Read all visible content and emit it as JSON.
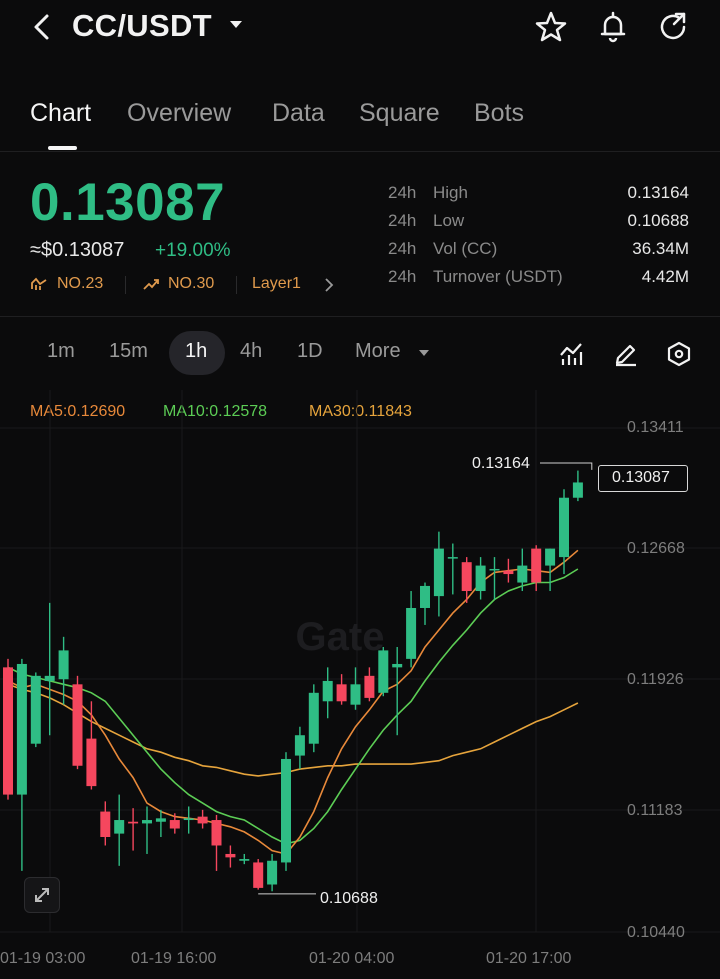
{
  "header": {
    "pair": "CC/USDT"
  },
  "tabs": [
    {
      "label": "Chart",
      "active": true
    },
    {
      "label": "Overview",
      "active": false
    },
    {
      "label": "Data",
      "active": false
    },
    {
      "label": "Square",
      "active": false
    },
    {
      "label": "Bots",
      "active": false
    }
  ],
  "ticker": {
    "last_price": "0.13087",
    "usd_value": "≈$0.13087",
    "change": "+19.00%",
    "rank1": "NO.23",
    "rank2": "NO.30",
    "category": "Layer1"
  },
  "stats": [
    {
      "period": "24h",
      "label": "High",
      "value": "0.13164"
    },
    {
      "period": "24h",
      "label": "Low",
      "value": "0.10688"
    },
    {
      "period": "24h",
      "label": "Vol (CC)",
      "value": "36.34M"
    },
    {
      "period": "24h",
      "label": "Turnover (USDT)",
      "value": "4.42M"
    }
  ],
  "intervals": [
    {
      "label": "1m",
      "active": false
    },
    {
      "label": "15m",
      "active": false
    },
    {
      "label": "1h",
      "active": true
    },
    {
      "label": "4h",
      "active": false
    },
    {
      "label": "1D",
      "active": false
    }
  ],
  "more_label": "More",
  "watermark": "Gate",
  "colors": {
    "up": "#2fbd85",
    "down": "#f5475e",
    "ma5": "#e8893a",
    "ma10": "#5ccd55",
    "ma30": "#e6a43c",
    "background": "#0b0b0c"
  },
  "chart_data": {
    "type": "candlestick",
    "interval": "1h",
    "ma_legend": [
      {
        "name": "MA5",
        "value": "0.12690",
        "text": "MA5:0.12690"
      },
      {
        "name": "MA10",
        "value": "0.12578",
        "text": "MA10:0.12578"
      },
      {
        "name": "MA30",
        "value": "0.11843",
        "text": "MA30:0.11843"
      }
    ],
    "y_ticks": [
      "0.13411",
      "0.12668",
      "0.11926",
      "0.11183",
      "0.10440"
    ],
    "ylim": [
      0.1044,
      0.13411
    ],
    "x_ticks": [
      {
        "label": "01-19 03:00",
        "index": 1
      },
      {
        "label": "01-19 16:00",
        "index": 14
      },
      {
        "label": "01-20 04:00",
        "index": 26
      },
      {
        "label": "01-20 17:00",
        "index": 39
      }
    ],
    "current_price_label": "0.13087",
    "high_marker": {
      "label": "0.13164",
      "value": 0.13164,
      "index": 42
    },
    "low_marker": {
      "label": "0.10688",
      "value": 0.10688,
      "index": 18
    },
    "candles": [
      {
        "o": 0.12,
        "h": 0.1205,
        "l": 0.1122,
        "c": 0.1125
      },
      {
        "o": 0.1125,
        "h": 0.1205,
        "l": 0.108,
        "c": 0.1202
      },
      {
        "o": 0.1155,
        "h": 0.1197,
        "l": 0.1153,
        "c": 0.1195
      },
      {
        "o": 0.1192,
        "h": 0.1238,
        "l": 0.116,
        "c": 0.1195
      },
      {
        "o": 0.1193,
        "h": 0.1218,
        "l": 0.1178,
        "c": 0.121
      },
      {
        "o": 0.119,
        "h": 0.1195,
        "l": 0.114,
        "c": 0.1142
      },
      {
        "o": 0.1158,
        "h": 0.118,
        "l": 0.1128,
        "c": 0.113
      },
      {
        "o": 0.1115,
        "h": 0.1121,
        "l": 0.1095,
        "c": 0.11
      },
      {
        "o": 0.1102,
        "h": 0.1125,
        "l": 0.1083,
        "c": 0.111
      },
      {
        "o": 0.1109,
        "h": 0.1117,
        "l": 0.1092,
        "c": 0.1108
      },
      {
        "o": 0.1108,
        "h": 0.1118,
        "l": 0.109,
        "c": 0.111
      },
      {
        "o": 0.1109,
        "h": 0.1116,
        "l": 0.11,
        "c": 0.1111
      },
      {
        "o": 0.111,
        "h": 0.1114,
        "l": 0.1102,
        "c": 0.1105
      },
      {
        "o": 0.111,
        "h": 0.1118,
        "l": 0.1102,
        "c": 0.1111
      },
      {
        "o": 0.1112,
        "h": 0.1116,
        "l": 0.1105,
        "c": 0.1108
      },
      {
        "o": 0.111,
        "h": 0.1113,
        "l": 0.108,
        "c": 0.1095
      },
      {
        "o": 0.109,
        "h": 0.1095,
        "l": 0.1082,
        "c": 0.1088
      },
      {
        "o": 0.1086,
        "h": 0.109,
        "l": 0.1084,
        "c": 0.1087
      },
      {
        "o": 0.1085,
        "h": 0.1087,
        "l": 0.1069,
        "c": 0.107
      },
      {
        "o": 0.1072,
        "h": 0.109,
        "l": 0.1068,
        "c": 0.1086
      },
      {
        "o": 0.1085,
        "h": 0.115,
        "l": 0.108,
        "c": 0.1146
      },
      {
        "o": 0.1148,
        "h": 0.1165,
        "l": 0.114,
        "c": 0.116
      },
      {
        "o": 0.1155,
        "h": 0.119,
        "l": 0.115,
        "c": 0.1185
      },
      {
        "o": 0.118,
        "h": 0.12,
        "l": 0.117,
        "c": 0.1192
      },
      {
        "o": 0.119,
        "h": 0.1196,
        "l": 0.1178,
        "c": 0.118
      },
      {
        "o": 0.1178,
        "h": 0.12,
        "l": 0.1175,
        "c": 0.119
      },
      {
        "o": 0.1195,
        "h": 0.12,
        "l": 0.118,
        "c": 0.1182
      },
      {
        "o": 0.1185,
        "h": 0.1212,
        "l": 0.1183,
        "c": 0.121
      },
      {
        "o": 0.12,
        "h": 0.1212,
        "l": 0.116,
        "c": 0.1202
      },
      {
        "o": 0.1205,
        "h": 0.1245,
        "l": 0.12,
        "c": 0.1235
      },
      {
        "o": 0.1235,
        "h": 0.125,
        "l": 0.1225,
        "c": 0.1248
      },
      {
        "o": 0.1242,
        "h": 0.128,
        "l": 0.123,
        "c": 0.127
      },
      {
        "o": 0.1265,
        "h": 0.1273,
        "l": 0.1243,
        "c": 0.1265
      },
      {
        "o": 0.1262,
        "h": 0.1265,
        "l": 0.1238,
        "c": 0.1245
      },
      {
        "o": 0.1245,
        "h": 0.1265,
        "l": 0.124,
        "c": 0.126
      },
      {
        "o": 0.1258,
        "h": 0.1265,
        "l": 0.124,
        "c": 0.1258
      },
      {
        "o": 0.1257,
        "h": 0.1264,
        "l": 0.125,
        "c": 0.1255
      },
      {
        "o": 0.125,
        "h": 0.127,
        "l": 0.1245,
        "c": 0.126
      },
      {
        "o": 0.127,
        "h": 0.1272,
        "l": 0.1245,
        "c": 0.125
      },
      {
        "o": 0.126,
        "h": 0.127,
        "l": 0.1245,
        "c": 0.127
      },
      {
        "o": 0.1265,
        "h": 0.1305,
        "l": 0.1255,
        "c": 0.13
      },
      {
        "o": 0.13,
        "h": 0.1316,
        "l": 0.1298,
        "c": 0.1309
      }
    ],
    "ma_lines": {
      "MA5": [
        0.1192,
        0.1188,
        0.119,
        0.1187,
        0.1184,
        0.118,
        0.1172,
        0.116,
        0.1146,
        0.1135,
        0.112,
        0.1115,
        0.1112,
        0.1111,
        0.111,
        0.1108,
        0.1106,
        0.1103,
        0.1098,
        0.1092,
        0.109,
        0.11,
        0.1115,
        0.1135,
        0.1152,
        0.1165,
        0.1175,
        0.1186,
        0.119,
        0.1198,
        0.1212,
        0.1222,
        0.1232,
        0.124,
        0.125,
        0.1256,
        0.1257,
        0.1258,
        0.1257,
        0.1256,
        0.1262,
        0.1269
      ],
      "MA10": [
        0.12,
        0.1196,
        0.1194,
        0.1192,
        0.119,
        0.1188,
        0.1185,
        0.118,
        0.117,
        0.116,
        0.115,
        0.114,
        0.1132,
        0.1125,
        0.112,
        0.1115,
        0.1112,
        0.111,
        0.1105,
        0.11,
        0.1096,
        0.1098,
        0.1105,
        0.1115,
        0.1128,
        0.114,
        0.1152,
        0.1163,
        0.1172,
        0.118,
        0.1192,
        0.1203,
        0.1213,
        0.1222,
        0.1232,
        0.124,
        0.1245,
        0.1248,
        0.125,
        0.125,
        0.1253,
        0.1258
      ],
      "MA30": [
        0.119,
        0.1187,
        0.1185,
        0.1182,
        0.1178,
        0.1173,
        0.1168,
        0.1164,
        0.116,
        0.1156,
        0.1152,
        0.115,
        0.1147,
        0.1145,
        0.1142,
        0.1141,
        0.1139,
        0.1137,
        0.1136,
        0.1137,
        0.1138,
        0.114,
        0.1141,
        0.1142,
        0.1142,
        0.1143,
        0.1143,
        0.1143,
        0.1143,
        0.1143,
        0.1144,
        0.1145,
        0.1148,
        0.115,
        0.1152,
        0.1156,
        0.116,
        0.1164,
        0.1168,
        0.1171,
        0.1175,
        0.1179
      ]
    }
  }
}
